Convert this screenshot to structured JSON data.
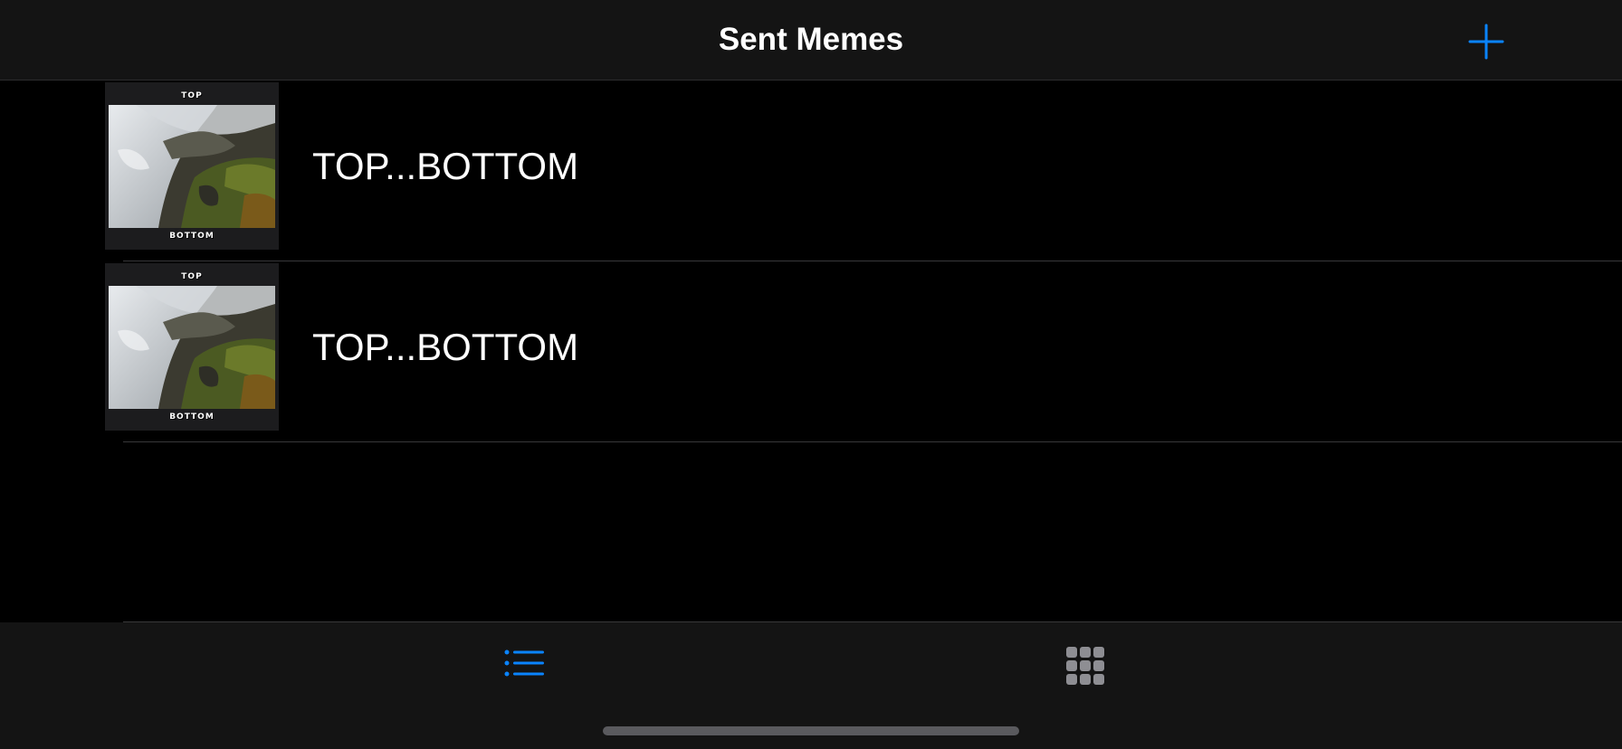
{
  "navbar": {
    "title": "Sent Memes",
    "add_icon": "plus-icon",
    "accent_color": "#0a84ff"
  },
  "memes": [
    {
      "title": "TOP...BOTTOM",
      "top_text": "TOP",
      "bottom_text": "BOTTOM",
      "image": "waterfall-rocks-photo"
    },
    {
      "title": "TOP...BOTTOM",
      "top_text": "TOP",
      "bottom_text": "BOTTOM",
      "image": "waterfall-rocks-photo"
    }
  ],
  "tabbar": {
    "tabs": [
      {
        "icon": "list-icon",
        "selected": true
      },
      {
        "icon": "grid-icon",
        "selected": false
      }
    ],
    "selected_color": "#0a84ff",
    "unselected_color": "#8e8e93"
  }
}
